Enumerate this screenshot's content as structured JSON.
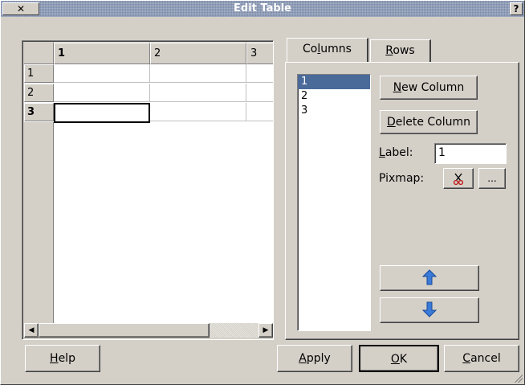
{
  "window": {
    "title": "Edit Table",
    "close_glyph": "✕",
    "help_glyph": "?"
  },
  "table": {
    "column_headers": [
      "1",
      "2",
      "3"
    ],
    "row_headers": [
      "1",
      "2",
      "3"
    ],
    "current_row": "3"
  },
  "tabs": [
    {
      "label_pre": "Co",
      "label_u": "l",
      "label_post": "umns",
      "active": true
    },
    {
      "label_pre": "",
      "label_u": "R",
      "label_post": "ows",
      "active": false
    }
  ],
  "columns_list": {
    "items": [
      "1",
      "2",
      "3"
    ],
    "selected": "1"
  },
  "buttons": {
    "new_column_u": "N",
    "new_column_rest": "ew Column",
    "delete_column_u": "D",
    "delete_column_rest": "elete Column",
    "pixmap_browse": "...",
    "help_u": "H",
    "help_rest": "elp",
    "apply_u": "A",
    "apply_rest": "pply",
    "ok_u": "O",
    "ok_rest": "K",
    "cancel_u": "C",
    "cancel_rest": "ancel"
  },
  "fields": {
    "label_u": "L",
    "label_rest": "abel:",
    "label_value": "1",
    "pixmap_label": "Pixmap:"
  },
  "icons": {
    "pixmap_clear": "scissors-icon",
    "move_up": "arrow-up-icon",
    "move_down": "arrow-down-icon",
    "scroll_left": "scroll-left-icon",
    "scroll_right": "scroll-right-icon"
  },
  "colors": {
    "selection": "#4a6a9a",
    "arrow_blue": "#3a7ad9"
  }
}
